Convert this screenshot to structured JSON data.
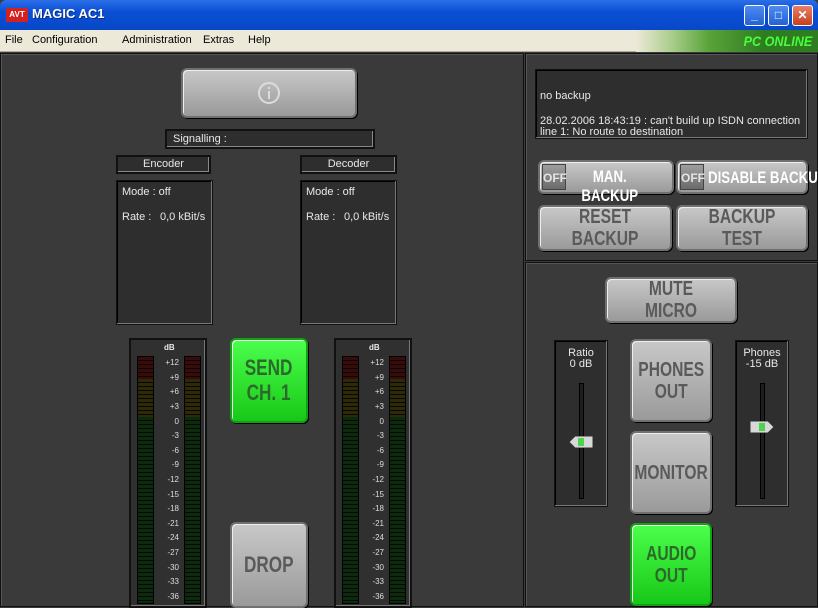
{
  "window": {
    "title": "MAGIC AC1",
    "logo": "AVT",
    "min": "_",
    "max": "□",
    "close": "✕"
  },
  "menu": [
    "File",
    "Configuration",
    "Administration",
    "Extras",
    "Help"
  ],
  "status": {
    "online": "PC ONLINE"
  },
  "left": {
    "signalling": "Signalling :",
    "encoder": {
      "title": "Encoder",
      "mode": "Mode : off",
      "rate_label": "Rate :",
      "rate_value": "0,0 kBit/s"
    },
    "decoder": {
      "title": "Decoder",
      "mode": "Mode : off",
      "rate_label": "Rate :",
      "rate_value": "0,0 kBit/s"
    },
    "meter_title": "dB",
    "meter_scale": [
      "+12",
      "+9",
      "+6",
      "+3",
      "0",
      "-3",
      "-6",
      "-9",
      "-12",
      "-15",
      "-18",
      "-21",
      "-24",
      "-27",
      "-30",
      "-33",
      "-36"
    ],
    "send": {
      "line1": "SEND",
      "line2": "CH. 1"
    },
    "drop": "DROP"
  },
  "backup": {
    "message": "no backup",
    "log_line1": "28.02.2006 18:43:19 : can't build up ISDN connection",
    "log_line2": "line 1: No route to destination",
    "man_off": "OFF",
    "man_label": "MAN. BACKUP",
    "dis_off": "OFF",
    "dis_label": "DISABLE BACKUP",
    "reset": "RESET BACKUP",
    "test": "BACKUP TEST"
  },
  "audio": {
    "mute": "MUTE MICRO",
    "ratio_label": "Ratio",
    "ratio_value": "0 dB",
    "ratio_level": 0.5,
    "phones_label": "Phones",
    "phones_value": "-15 dB",
    "phones_level": 0.63,
    "phones_out": {
      "line1": "PHONES",
      "line2": "OUT"
    },
    "monitor": "MONITOR",
    "audio_out": {
      "line1": "AUDIO",
      "line2": "OUT"
    }
  },
  "colors": {
    "active": "#22dd22",
    "online": "#46ff3c",
    "titlebar": "#0a4fd4"
  }
}
